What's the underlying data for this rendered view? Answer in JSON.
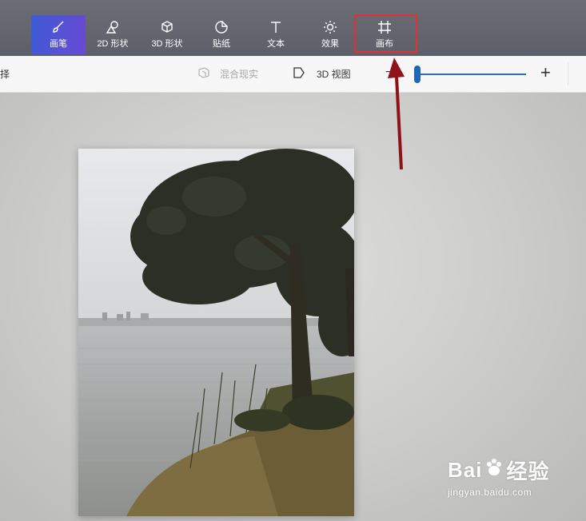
{
  "toolbar": {
    "tools": [
      {
        "label": "画笔",
        "icon": "brush-icon",
        "active": true
      },
      {
        "label": "2D 形状",
        "icon": "2d-shapes-icon",
        "active": false
      },
      {
        "label": "3D 形状",
        "icon": "3d-shapes-icon",
        "active": false
      },
      {
        "label": "贴纸",
        "icon": "stickers-icon",
        "active": false
      },
      {
        "label": "文本",
        "icon": "text-icon",
        "active": false
      },
      {
        "label": "效果",
        "icon": "effects-icon",
        "active": false
      },
      {
        "label": "画布",
        "icon": "canvas-icon",
        "active": false
      }
    ],
    "highlight_color": "#e0303a",
    "active_gradient": [
      "#3e5bd6",
      "#6a49d4"
    ]
  },
  "subbar": {
    "left_text": "择",
    "mixed_reality_label": "混合现实",
    "view3d_label": "3D 视图",
    "zoom_minus": "−",
    "zoom_plus": "+",
    "zoom_fraction": 0.0,
    "accent": "#1f66b5"
  },
  "watermark": {
    "brand_left": "Bai",
    "brand_right": "经验",
    "url": "jingyan.baidu.com"
  }
}
